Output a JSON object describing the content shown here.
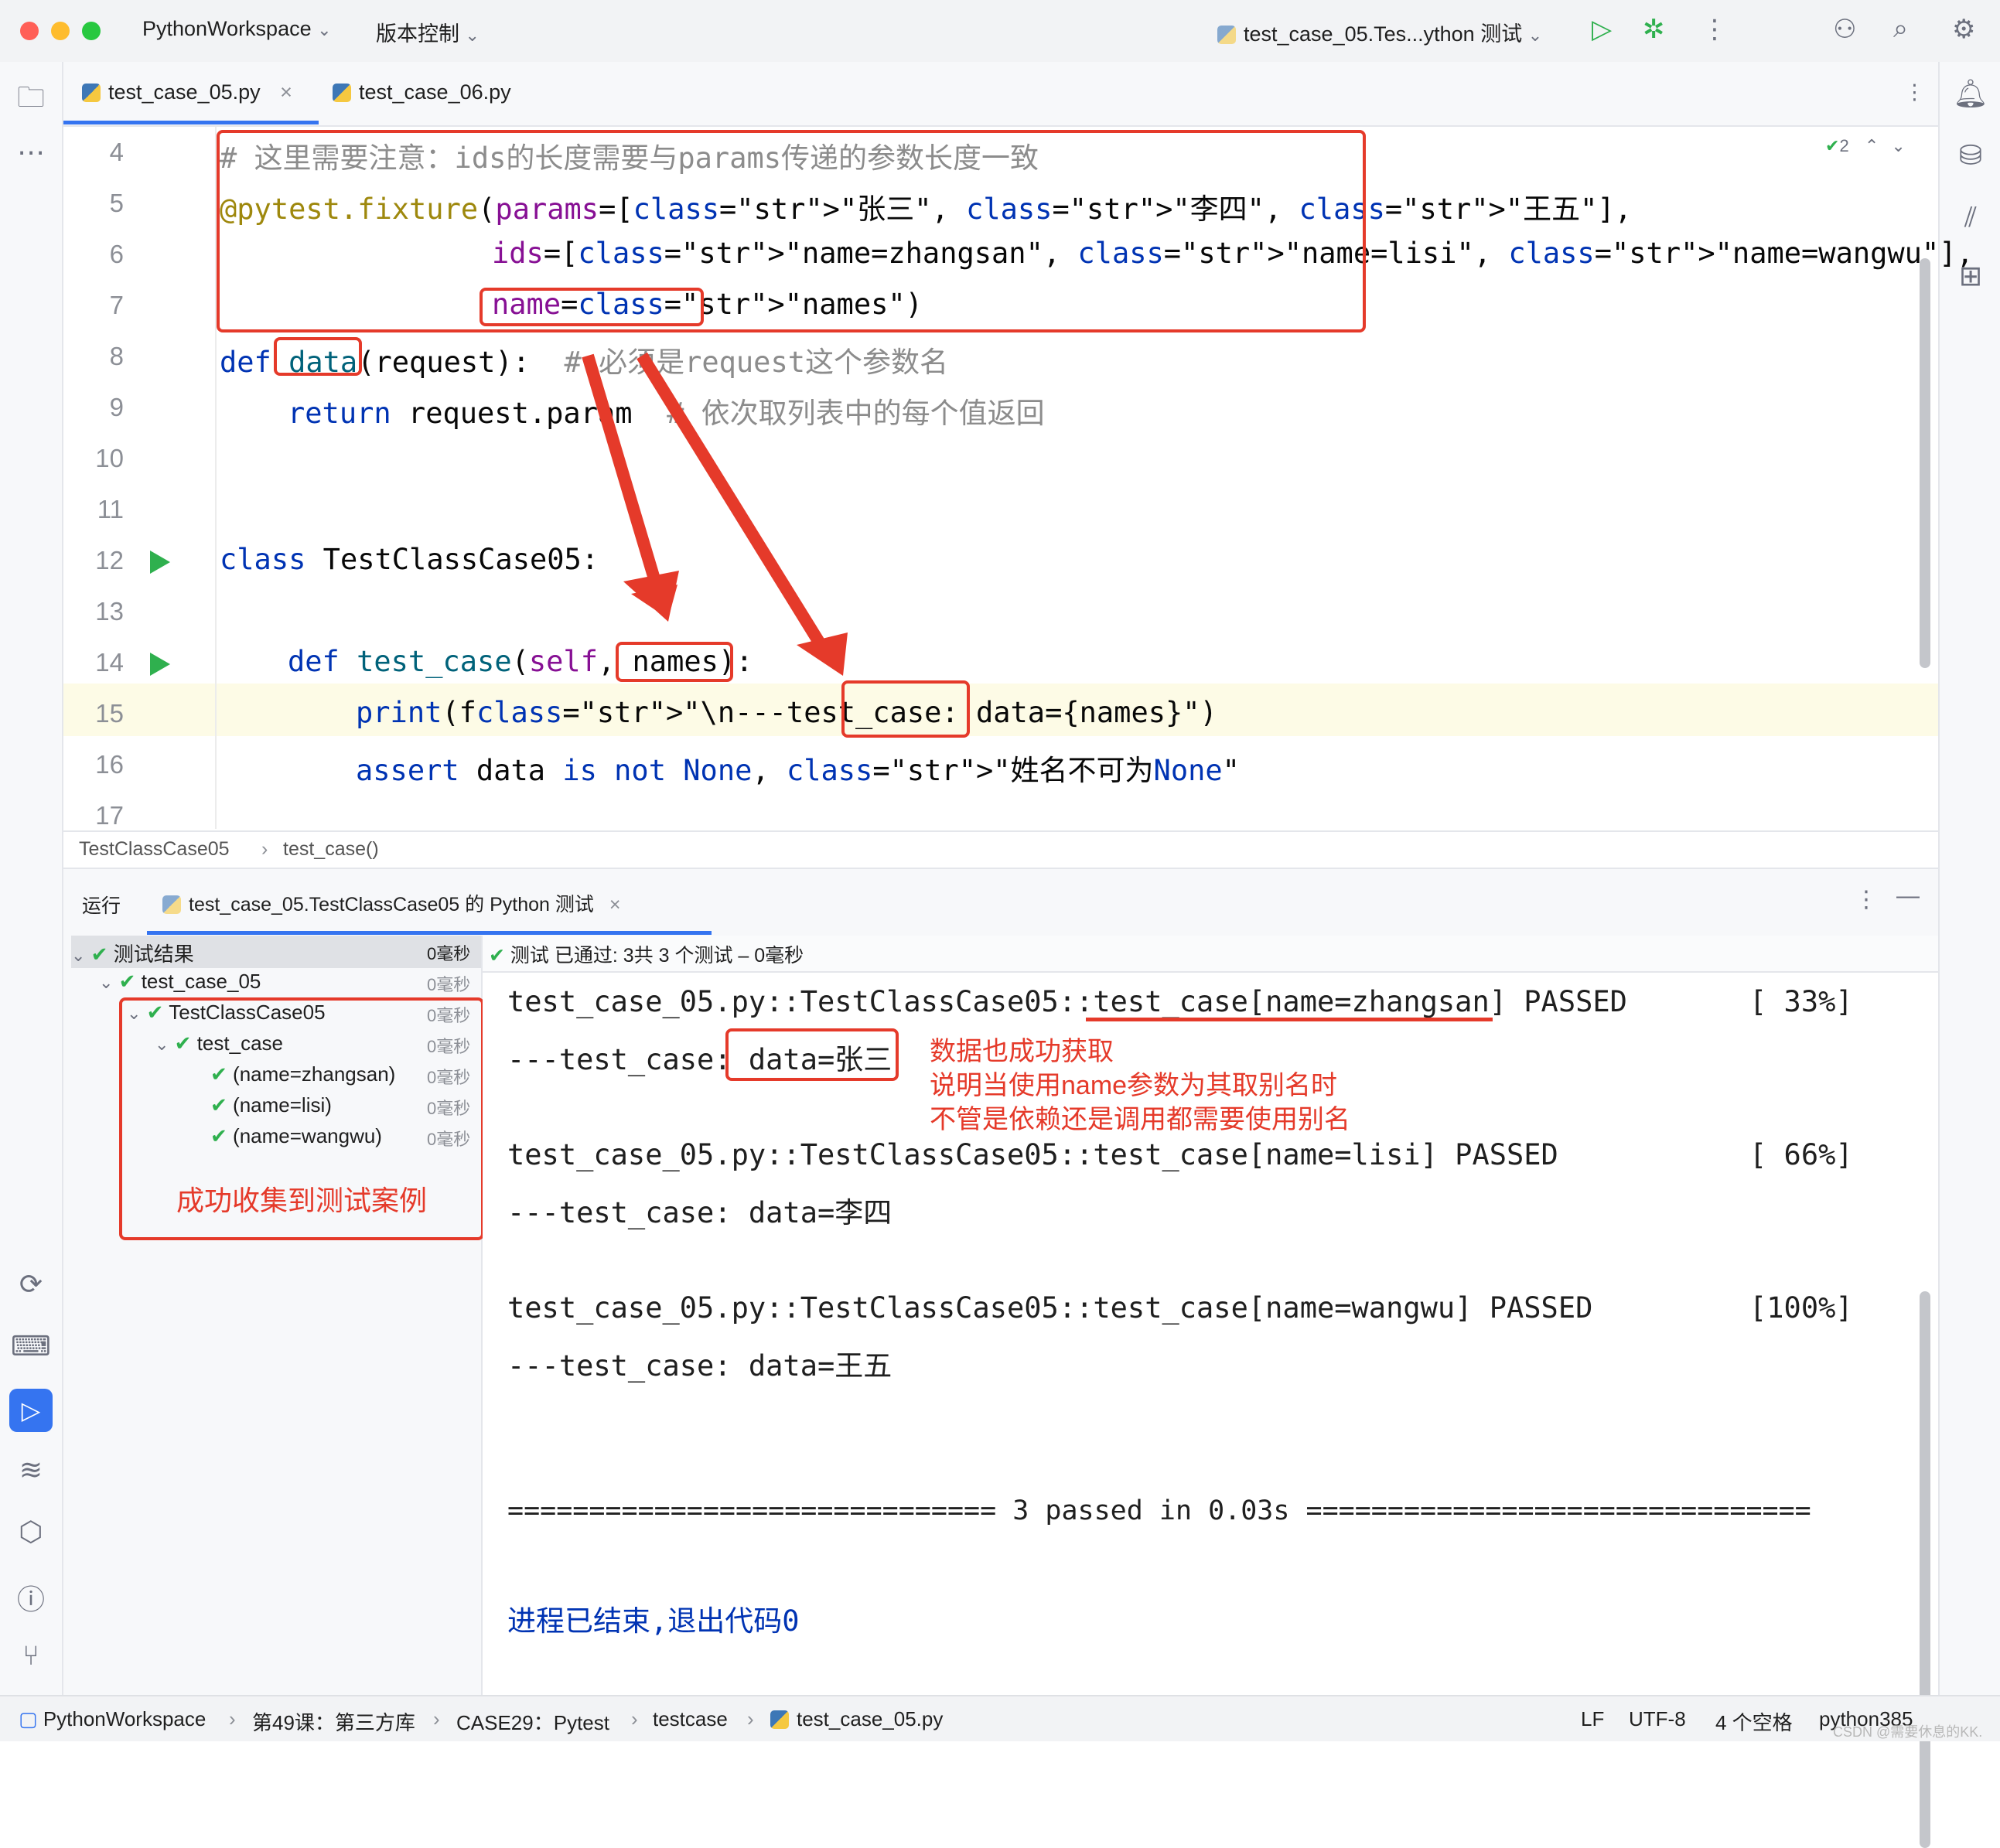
{
  "colors": {
    "accent": "#3574f0",
    "annotation_red": "#e53a2a",
    "success_green": "#2fb04e"
  },
  "titlebar": {
    "project": "PythonWorkspace",
    "vcs": "版本控制",
    "run_config": "test_case_05.Tes...ython 测试",
    "icons": [
      "run-icon",
      "debug-icon",
      "more-icon",
      "add-user-icon",
      "search-icon",
      "settings-icon"
    ]
  },
  "editor_tabs": [
    {
      "label": "test_case_05.py",
      "active": true
    },
    {
      "label": "test_case_06.py",
      "active": false
    }
  ],
  "inspection": {
    "count": "2"
  },
  "code": {
    "lines": [
      {
        "no": "4",
        "t": "# 这里需要注意：ids的长度需要与params传递的参数长度一致"
      },
      {
        "no": "5",
        "t": "@pytest.fixture(params=[\"张三\", \"李四\", \"王五\"],"
      },
      {
        "no": "6",
        "t": "ids=[\"name=zhangsan\", \"name=lisi\", \"name=wangwu\"],"
      },
      {
        "no": "7",
        "t": "name=\"names\")"
      },
      {
        "no": "8",
        "t": "def data(request):  # 必须是request这个参数名"
      },
      {
        "no": "9",
        "t": "return request.param  # 依次取列表中的每个值返回"
      },
      {
        "no": "10",
        "t": ""
      },
      {
        "no": "11",
        "t": ""
      },
      {
        "no": "12",
        "t": "class TestClassCase05:"
      },
      {
        "no": "13",
        "t": ""
      },
      {
        "no": "14",
        "t": "def test_case(self, names):"
      },
      {
        "no": "15",
        "t": "print(f\"\\n---test_case: data={names}\")"
      },
      {
        "no": "16",
        "t": "assert data is not None, \"姓名不可为None\""
      },
      {
        "no": "17",
        "t": ""
      }
    ]
  },
  "editor_breadcrumb": [
    "TestClassCase05",
    "test_case()"
  ],
  "run_panel": {
    "label": "运行",
    "tab": "test_case_05.TestClassCase05 的 Python 测试",
    "summary": "测试 已通过: 3共 3 个测试 – 0毫秒",
    "tree": [
      {
        "label": "测试结果",
        "time": "0毫秒"
      },
      {
        "label": "test_case_05",
        "time": "0毫秒"
      },
      {
        "label": "TestClassCase05",
        "time": "0毫秒"
      },
      {
        "label": "test_case",
        "time": "0毫秒"
      },
      {
        "label": "(name=zhangsan)",
        "time": "0毫秒"
      },
      {
        "label": "(name=lisi)",
        "time": "0毫秒"
      },
      {
        "label": "(name=wangwu)",
        "time": "0毫秒"
      }
    ],
    "console": [
      "test_case_05.py::TestClassCase05::test_case[name=zhangsan] PASSED",
      "---test_case: data=张三",
      "test_case_05.py::TestClassCase05::test_case[name=lisi] PASSED",
      "---test_case: data=李四",
      "test_case_05.py::TestClassCase05::test_case[name=wangwu] PASSED",
      "---test_case: data=王五",
      "============================== 3 passed in 0.03s ===============================",
      "进程已结束,退出代码0"
    ],
    "percents": [
      "[ 33%]",
      "[ 66%]",
      "[100%]"
    ]
  },
  "annotations": {
    "tree_note": "成功收集到测试案例",
    "console_note": [
      "数据也成功获取",
      "说明当使用name参数为其取别名时",
      "不管是依赖还是调用都需要使用别名"
    ]
  },
  "statusbar": {
    "path": [
      "PythonWorkspace",
      "第49课：第三方库",
      "CASE29：Pytest",
      "testcase",
      "test_case_05.py"
    ],
    "lf": "LF",
    "encoding": "UTF-8",
    "indent": "4 个空格",
    "interpreter": "python385",
    "watermark": "CSDN @需要休息的KK."
  }
}
